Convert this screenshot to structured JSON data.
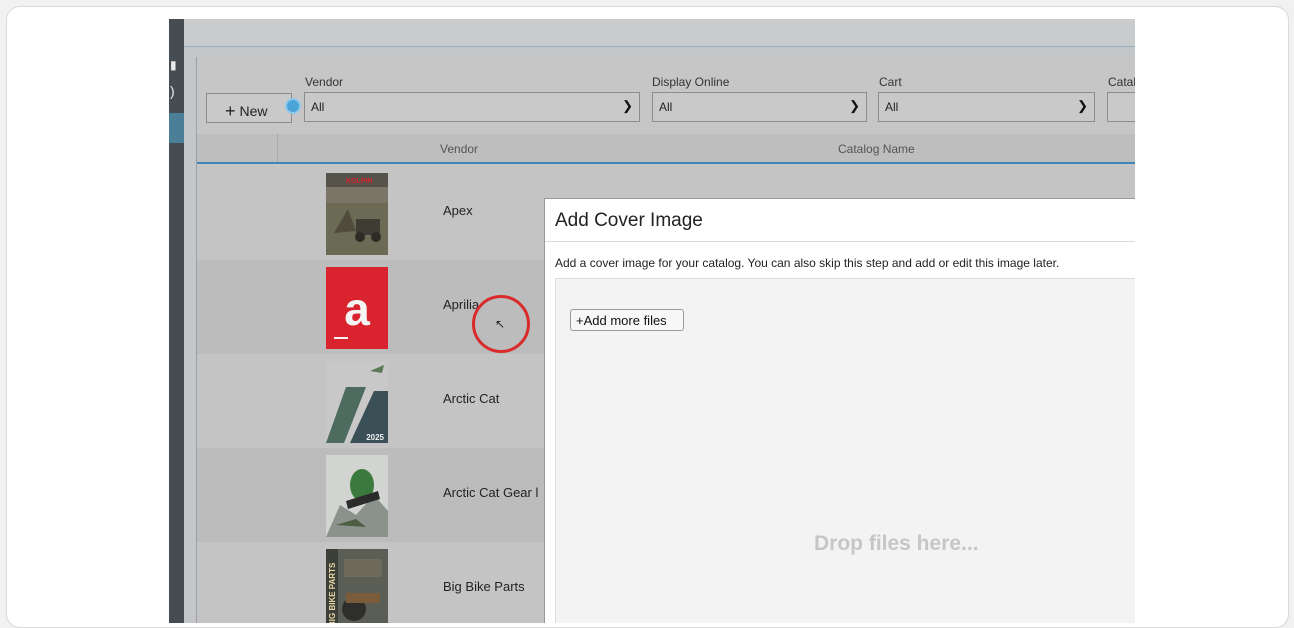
{
  "left_nav": {
    "glyph_top": "▮",
    "glyph_bottom": ")"
  },
  "toolbar": {
    "new_button": {
      "icon": "plus-icon",
      "label": "New"
    },
    "info_icon": "info-icon"
  },
  "filters": [
    {
      "key": "vendor",
      "label": "Vendor",
      "value": "All"
    },
    {
      "key": "display_online",
      "label": "Display Online",
      "value": "All"
    },
    {
      "key": "cart",
      "label": "Cart",
      "value": "All"
    },
    {
      "key": "catalog",
      "label": "Catal",
      "value": ""
    }
  ],
  "table": {
    "columns": [
      "Vendor",
      "Catalog Name"
    ],
    "rows": [
      {
        "vendor": "Apex",
        "thumb_text": "KOLPIN"
      },
      {
        "vendor": "Aprilia",
        "thumb_text": "a"
      },
      {
        "vendor": "Arctic Cat",
        "thumb_text": "2025"
      },
      {
        "vendor": "Arctic Cat Gear l",
        "thumb_text": ""
      },
      {
        "vendor": "Big Bike Parts",
        "thumb_text": "BIG BIKE PARTS"
      }
    ]
  },
  "dialog": {
    "title": "Add Cover Image",
    "description": "Add a cover image for your catalog. You can also skip this step and add or edit this image later.",
    "add_button": "+Add more files",
    "drop_hint": "Drop files here..."
  },
  "colors": {
    "accent": "#3f86b8",
    "highlight_ring": "#d92b2b",
    "aprilia_red": "#d9232e"
  }
}
